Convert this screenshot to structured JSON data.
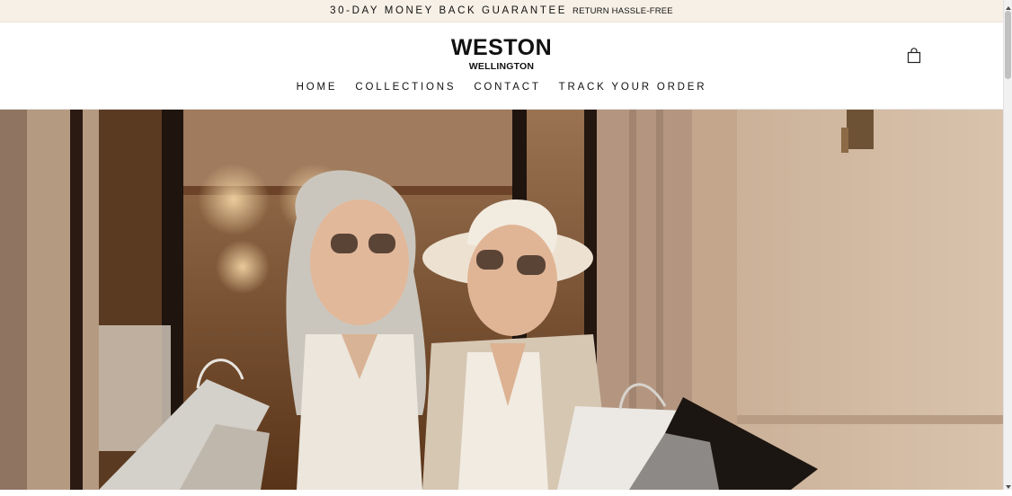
{
  "announcement": {
    "primary": "30-DAY MONEY BACK GUARANTEE",
    "secondary": "RETURN HASSLE-FREE"
  },
  "brand": {
    "name": "WESTON",
    "subname": "WELLINGTON"
  },
  "nav": {
    "items": [
      "HOME",
      "COLLECTIONS",
      "CONTACT",
      "TRACK YOUR ORDER"
    ]
  },
  "header": {
    "cart_icon": "shopping-bag-icon"
  },
  "hero": {
    "image": "two-women-shopping-bags-photo"
  },
  "colors": {
    "announcement_bg": "#f6f0e6",
    "text": "#111111",
    "hero_wall": "#cdb49b",
    "hero_shop": "#7a4a27"
  }
}
